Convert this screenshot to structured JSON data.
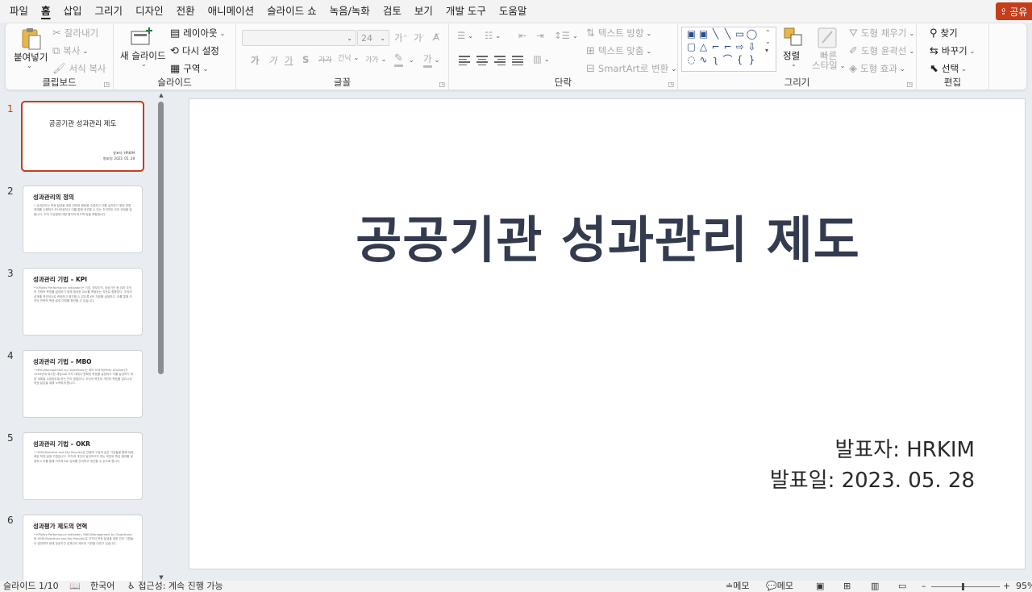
{
  "menu": {
    "items": [
      "파일",
      "홈",
      "삽입",
      "그리기",
      "디자인",
      "전환",
      "애니메이션",
      "슬라이드 쇼",
      "녹음/녹화",
      "검토",
      "보기",
      "개발 도구",
      "도움말"
    ],
    "active_index": 1,
    "share_label": "공유"
  },
  "ribbon": {
    "clipboard": {
      "paste": "붙여넣기",
      "cut": "잘라내기",
      "copy": "복사",
      "format_painter": "서식 복사",
      "label": "클립보드"
    },
    "slides": {
      "new_slide": "새 슬라이드",
      "layout": "레이아웃",
      "reset": "다시 설정",
      "section": "구역",
      "label": "슬라이드"
    },
    "font": {
      "font_name": "",
      "font_size": "24",
      "label": "글꼴",
      "bold": "가",
      "italic": "가",
      "underline": "가",
      "shadow": "S",
      "strike": "가가",
      "spacing": "간닉",
      "case": "가가",
      "highlight": "가",
      "color": "가"
    },
    "paragraph": {
      "text_direction": "텍스트 방향",
      "align_text": "텍스트 맞춤",
      "smartart": "SmartArt로 변환",
      "label": "단락"
    },
    "drawing": {
      "arrange": "정렬",
      "quick_styles_1": "빠른",
      "quick_styles_2": "스타일",
      "shape_fill": "도형 채우기",
      "shape_outline": "도형 윤곽선",
      "shape_effects": "도형 효과",
      "label": "그리기"
    },
    "editing": {
      "find": "찾기",
      "replace": "바꾸기",
      "select": "선택",
      "label": "편집"
    }
  },
  "thumbnails": [
    {
      "num": "1",
      "title": "공공기관 성과관리 제도",
      "presenter": "발표자: HRKIM",
      "date": "발표일: 2023. 05. 28",
      "body": ""
    },
    {
      "num": "2",
      "title": "성과관리의 정의",
      "body": "• 성과관리는 목표 달성을 위한 전략과 행동을 수립하고 이를 실천하기 위한 방법 체계를 수행하고 모니터링하고 이를 통해 개선할 수 있는 조직적인 관리 과정을 말합니다. 조직 구성원에 대한 평가와 피드백 등을 포함합니다."
    },
    {
      "num": "3",
      "title": "성과관리 기법 – KPI",
      "body": "• KPI(Key Performance Indicator)는 기업, 정부조직, 공공기관 등 여러 조직의 전략적 목표를 달성하기 위해 중요한 요소를 측정하는 지표로 활용된다. 조직의 성과를 객관적으로 측정하고 평가할 수 있도록 KPI 지표를 설정하고, 이를 통해 조직의 전략적 목표 달성 여부를 확인할 수 있습니다."
    },
    {
      "num": "4",
      "title": "성과관리 기법 – MBO",
      "body": "• MBO(Management by Objectives)는 피터 드러커(Peter Drucker)가 1954년에 제시한 개념으로 조직 내에서 명확한 목표를 설정하고 이를 달성하기 위한 계획을 수립하도록 하는 관리 방법이다. 조직의 목표와 개인의 목표를 일치시켜 목표 달성을 위해 노력하게 합니다."
    },
    {
      "num": "5",
      "title": "성과관리 기법 – OKR",
      "body": "• OKR(Objective and Key Results)은 인텔과 구글과 같은 기업들을 통해 대중화된 목표 설정 기법입니다. 조직과 개인이 달성하고자 하는 목표와 핵심 결과를 설정하고 이를 통해 지속적으로 성과를 관리하고 개선할 수 있도록 합니다."
    },
    {
      "num": "6",
      "title": "성과평가 제도의 연혁",
      "body": "• KPI(Key Performance Indicator), MBO(Management by Objectives) 등 OKR(Objectives and Key Results)은 조직이 목표 달성을 위한 관리 기법들이 발전하며 현재 공공기관 성과관리 제도의 기반을 이루고 있습니다."
    }
  ],
  "slide": {
    "title": "공공기관 성과관리 제도",
    "presenter": "발표자: HRKIM",
    "date": "발표일: 2023. 05. 28"
  },
  "status": {
    "slide_count": "슬라이드 1/10",
    "language": "한국어",
    "accessibility": "접근성: 계속 진행 가능",
    "notes": "메모",
    "comments": "메모",
    "zoom_minus": "–",
    "zoom_plus": "+",
    "zoom": "95%"
  },
  "colors": {
    "accent": "#c43e1c",
    "title_text": "#343b4f"
  }
}
